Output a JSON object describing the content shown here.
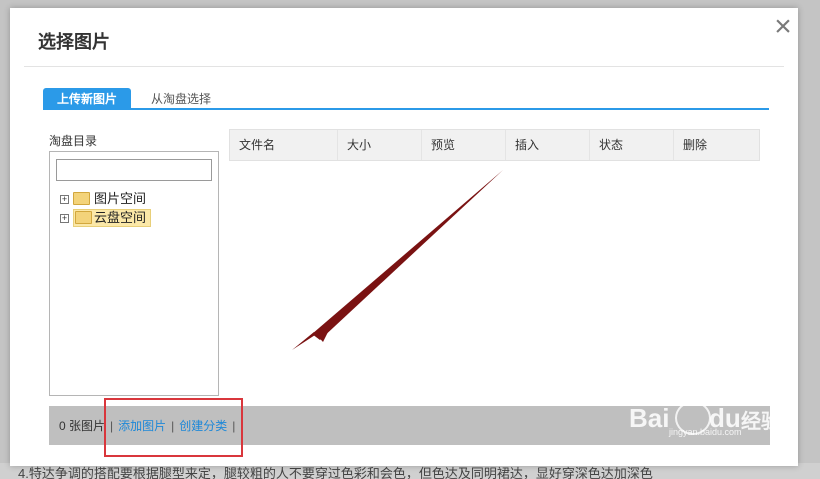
{
  "dialog": {
    "title": "选择图片",
    "close_glyph": "×"
  },
  "tabs": [
    {
      "label": "上传新图片",
      "active": true
    },
    {
      "label": "从淘盘选择",
      "active": false
    }
  ],
  "tree": {
    "label": "淘盘目录",
    "search_value": "",
    "nodes": [
      {
        "label": "图片空间",
        "expander": "+",
        "selected": false
      },
      {
        "label": "云盘空间",
        "expander": "+",
        "selected": true
      }
    ]
  },
  "table": {
    "headers": [
      "文件名",
      "大小",
      "预览",
      "插入",
      "状态",
      "删除"
    ]
  },
  "status": {
    "count_text": "0 张图片",
    "separator": "|",
    "add_link": "添加图片",
    "create_link": "创建分类"
  },
  "background": {
    "bottom_text": "4.特达争调的搭配要根据腿型来定，腿较粗的人不要穿过色彩和会色，但色达及同明裙达，显好穿深色达加深色"
  },
  "watermark": {
    "brand": "Bai",
    "du": "du",
    "jingyan": "经验",
    "url": "jingyan.baidu.com"
  },
  "colors": {
    "accent": "#2b9ae8",
    "link": "#1d88d8",
    "highlight": "#d9363c",
    "arrow": "#7a1212"
  }
}
